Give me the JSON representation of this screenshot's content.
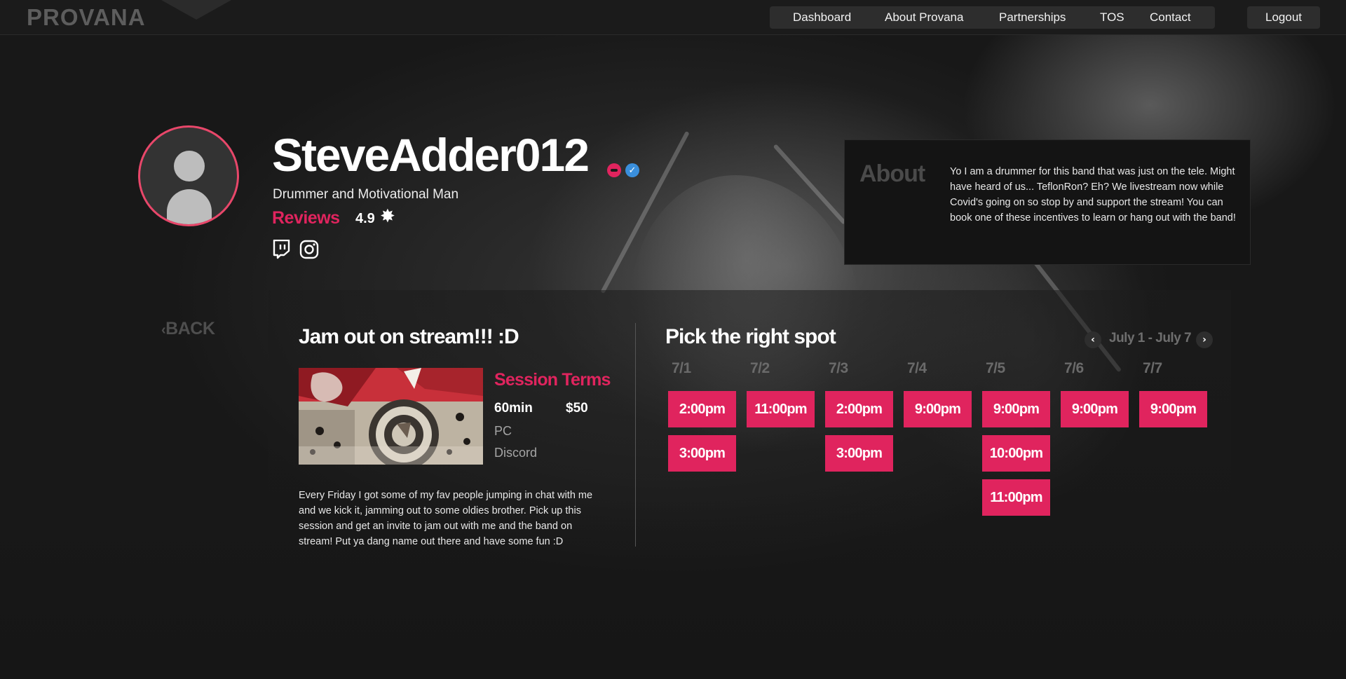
{
  "nav": {
    "logo": "PROVANA",
    "items": [
      "Dashboard",
      "About Provana",
      "Partnerships",
      "TOS",
      "Contact"
    ],
    "logout": "Logout"
  },
  "profile": {
    "username": "SteveAdder012",
    "tagline": "Drummer and Motivational Man",
    "reviews_label": "Reviews",
    "rating": "4.9"
  },
  "about": {
    "title": "About",
    "text": "Yo I am a drummer for this band that was just on the tele. Might have heard of us... TeflonRon? Eh? We livestream now while Covid's going on so stop by and support the stream! You can book one of these incentives to learn or hang out with the band!"
  },
  "back_label": "BACK",
  "session": {
    "title": "Jam out on stream!!! :D",
    "terms_title": "Session Terms",
    "duration": "60min",
    "price": "$50",
    "platform": "PC",
    "channel": "Discord",
    "description": "Every Friday I got some of my fav people jumping in chat with me and we kick it, jamming out to some oldies brother. Pick up this session and get an invite to jam out with me and the band on stream! Put ya dang name out there and have some fun :D"
  },
  "schedule": {
    "title": "Pick the right spot",
    "week_range": "July 1 - July 7",
    "days": [
      {
        "label": "7/1",
        "slots": [
          "2:00pm",
          "3:00pm"
        ]
      },
      {
        "label": "7/2",
        "slots": [
          "11:00pm"
        ]
      },
      {
        "label": "7/3",
        "slots": [
          "2:00pm",
          "3:00pm"
        ]
      },
      {
        "label": "7/4",
        "slots": [
          "9:00pm"
        ]
      },
      {
        "label": "7/5",
        "slots": [
          "9:00pm",
          "10:00pm",
          "11:00pm"
        ]
      },
      {
        "label": "7/6",
        "slots": [
          "9:00pm"
        ]
      },
      {
        "label": "7/7",
        "slots": [
          "9:00pm"
        ]
      }
    ]
  },
  "colors": {
    "accent": "#e0245e",
    "avatar_ring": "#e8476a",
    "verified": "#3a8fdc",
    "background": "#181818"
  },
  "icons": {
    "verified": "check-badge-icon",
    "skull": "skull-badge-icon",
    "star": "star-icon",
    "twitch": "twitch-icon",
    "instagram": "instagram-icon",
    "prev": "chevron-left-icon",
    "next": "chevron-right-icon",
    "back": "chevron-left-icon"
  }
}
